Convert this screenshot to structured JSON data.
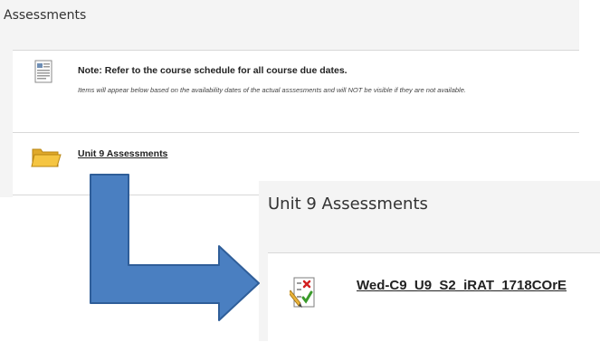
{
  "course_content": {
    "heading": "Assessments",
    "note": {
      "title": "Note: Refer to the course schedule for all course due dates.",
      "body": "Items will appear below based on the availability dates of the actual asssesments and will NOT be visible if they are not available.",
      "icon": "document-icon"
    },
    "folder": {
      "label": "Unit 9 Assessments",
      "icon": "folder-icon"
    }
  },
  "folder_contents": {
    "heading": "Unit 9 Assessments",
    "test": {
      "label": "Wed-C9_U9_S2_iRAT_1718COrE",
      "icon": "test-icon"
    }
  },
  "annotation": {
    "arrow_color": "#4a7fc1",
    "arrow_outline": "#2f5e99"
  },
  "colors": {
    "panel_bg": "#f4f4f4",
    "text": "#222222",
    "folder_yellow": "#f5c542"
  }
}
